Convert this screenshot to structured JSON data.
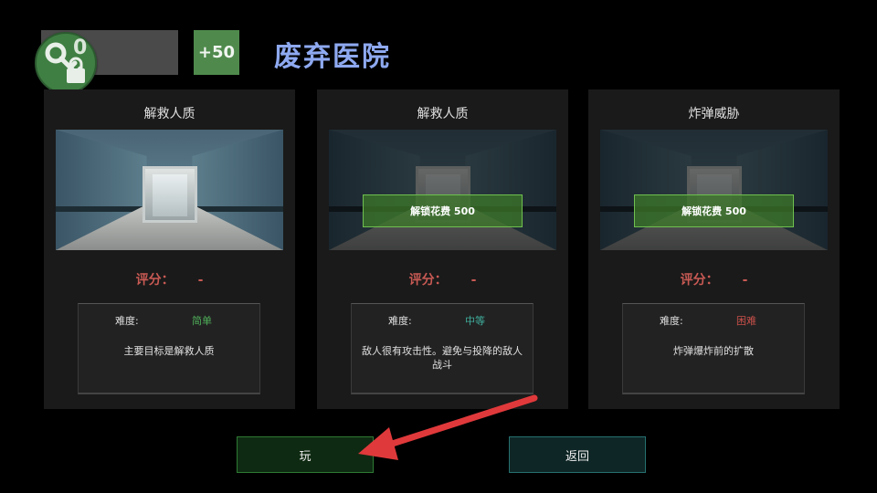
{
  "header": {
    "key_count": "0",
    "bonus_label": "+50",
    "map_title": "废弃医院"
  },
  "missions": [
    {
      "title": "解救人质",
      "unlock_label": "",
      "score_label": "评分：",
      "score_value": "-",
      "difficulty_label": "难度:",
      "difficulty_value": "简单",
      "difficulty_color": "#4fb05a",
      "description": "主要目标是解救人质"
    },
    {
      "title": "解救人质",
      "unlock_label": "解锁花费 500",
      "score_label": "评分：",
      "score_value": "-",
      "difficulty_label": "难度:",
      "difficulty_value": "中等",
      "difficulty_color": "#3fae9c",
      "description": "敌人很有攻击性。避免与投降的敌人战斗"
    },
    {
      "title": "炸弹威胁",
      "unlock_label": "解锁花费 500",
      "score_label": "评分：",
      "score_value": "-",
      "difficulty_label": "难度:",
      "difficulty_value": "困难",
      "difficulty_color": "#c9504a",
      "description": "炸弹爆炸前的扩散"
    }
  ],
  "buttons": {
    "play_label": "玩",
    "back_label": "返回"
  },
  "colors": {
    "accent_blue": "#8ea9f0",
    "score_red": "#c95a54",
    "key_green": "#3f7f43",
    "arrow_red": "#e0393b"
  },
  "icons": {
    "key_lock": "key-lock-icon",
    "arrow": "red-arrow-annotation"
  }
}
